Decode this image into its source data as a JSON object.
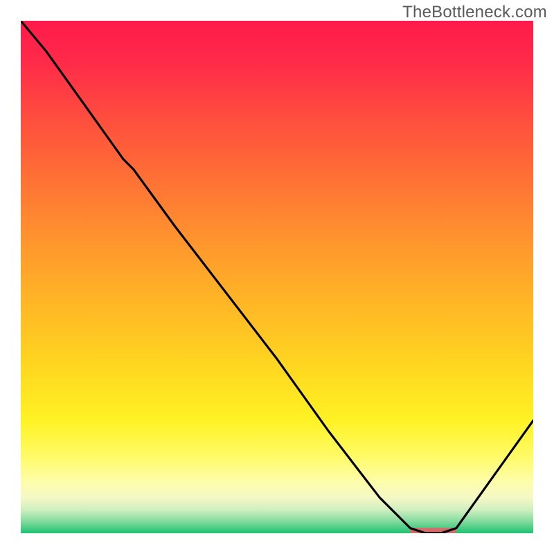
{
  "attribution": "TheBottleneck.com",
  "chart_data": {
    "type": "line",
    "title": "",
    "xlabel": "",
    "ylabel": "",
    "xlim": [
      0,
      100
    ],
    "ylim": [
      0,
      100
    ],
    "grid": false,
    "legend": false,
    "series": [
      {
        "name": "bottleneck-curve",
        "x": [
          0,
          5,
          10,
          15,
          20,
          22,
          30,
          40,
          50,
          60,
          70,
          76,
          79,
          82,
          85,
          90,
          95,
          100
        ],
        "y": [
          100,
          94,
          87,
          80,
          73,
          71,
          60,
          47,
          34,
          20,
          7,
          1,
          0,
          0,
          1,
          8,
          15,
          22
        ]
      }
    ],
    "marker": {
      "name": "optimal-segment",
      "x_start": 76,
      "x_end": 85,
      "y": 0.5,
      "color": "#d46a6a"
    },
    "background_gradient": {
      "stops": [
        {
          "offset": 0.0,
          "color": "#ff1a4b"
        },
        {
          "offset": 0.08,
          "color": "#ff2a49"
        },
        {
          "offset": 0.18,
          "color": "#ff4a3f"
        },
        {
          "offset": 0.3,
          "color": "#ff6e36"
        },
        {
          "offset": 0.42,
          "color": "#ff922e"
        },
        {
          "offset": 0.55,
          "color": "#ffb626"
        },
        {
          "offset": 0.68,
          "color": "#ffd820"
        },
        {
          "offset": 0.78,
          "color": "#fff224"
        },
        {
          "offset": 0.85,
          "color": "#fffb66"
        },
        {
          "offset": 0.9,
          "color": "#fdfdab"
        },
        {
          "offset": 0.93,
          "color": "#f5f9c4"
        },
        {
          "offset": 0.955,
          "color": "#ceeec0"
        },
        {
          "offset": 0.975,
          "color": "#8adca0"
        },
        {
          "offset": 1.0,
          "color": "#1fc373"
        }
      ]
    }
  }
}
